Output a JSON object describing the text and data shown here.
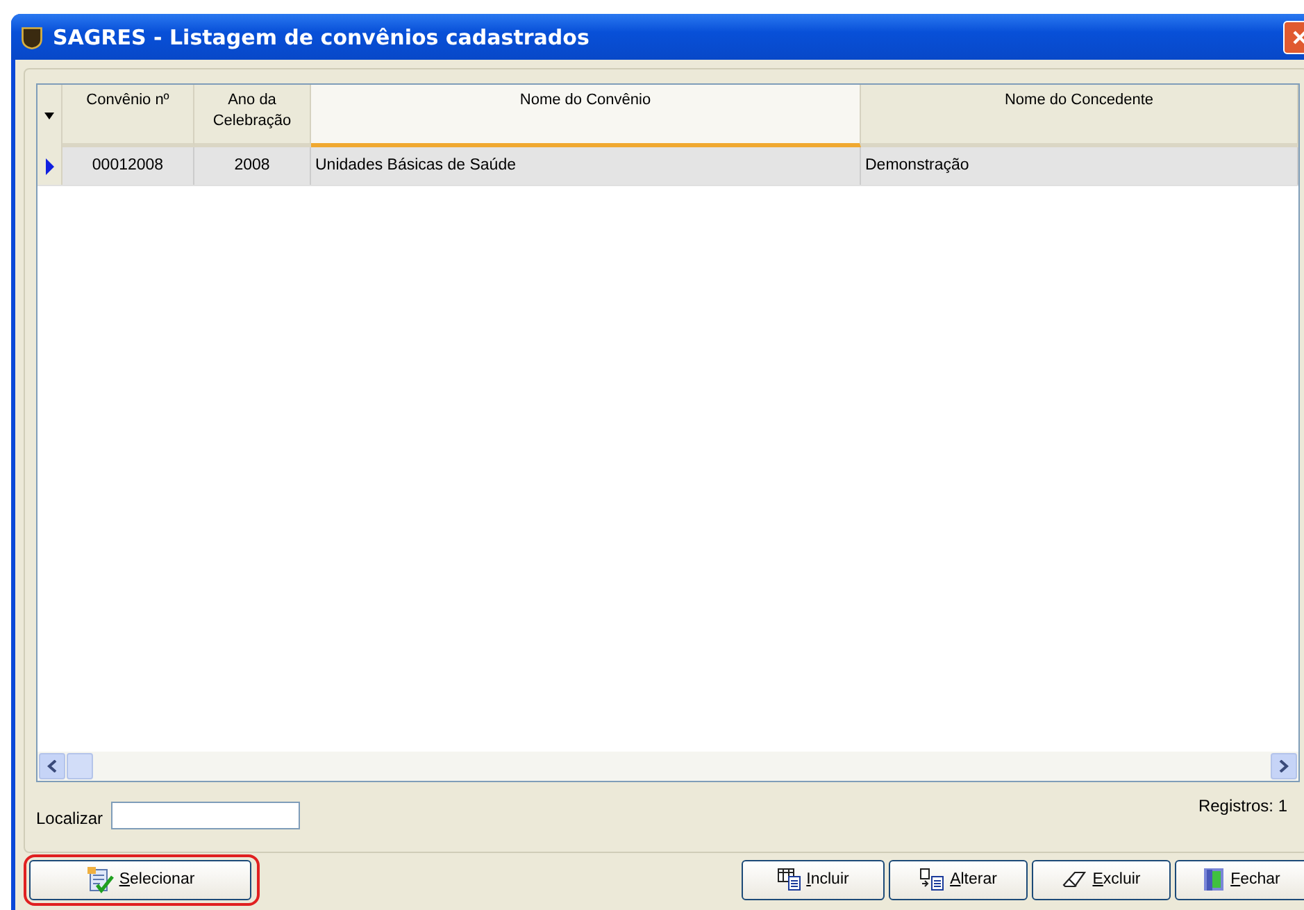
{
  "window": {
    "title": "SAGRES - Listagem de convênios cadastrados"
  },
  "table": {
    "columns": [
      {
        "label": "Convênio nº",
        "sorted": false
      },
      {
        "label": "Ano da Celebração",
        "sorted": false
      },
      {
        "label": "Nome do Convênio",
        "sorted": true
      },
      {
        "label": "Nome do Concedente",
        "sorted": false
      }
    ],
    "rows": [
      {
        "selected": true,
        "cells": [
          "00012008",
          "2008",
          "Unidades Básicas de Saúde",
          "Demonstração"
        ]
      }
    ]
  },
  "search": {
    "label": "Localizar"
  },
  "record_count": "Registros: 1",
  "buttons": [
    {
      "kind": "select",
      "label": "Selecionar",
      "highlighted": true
    },
    {
      "kind": "add",
      "label": "Incluir",
      "highlighted": false
    },
    {
      "kind": "edit",
      "label": "Alterar",
      "highlighted": false
    },
    {
      "kind": "delete",
      "label": "Excluir",
      "highlighted": false
    },
    {
      "kind": "close",
      "label": "Fechar",
      "highlighted": false
    }
  ]
}
